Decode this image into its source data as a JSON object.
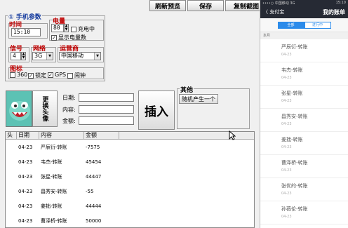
{
  "toolbar": {
    "refresh_label": "刷新预览",
    "save_label": "保存",
    "copy_label": "复制截图"
  },
  "phone_params": {
    "legend": "① 手机参数",
    "time_label": "时间",
    "time_value": "15:10",
    "battery_label": "电量",
    "battery_value": "80",
    "charging_label": "充电中",
    "charging_checked": false,
    "show_battery_label": "显示电量数",
    "show_battery_checked": true,
    "signal_label": "信号",
    "signal_value": "4",
    "network_label": "网络",
    "network_value": "3G",
    "carrier_label": "运营商",
    "carrier_value": "中国移动",
    "icons_label": "图标",
    "icon_options": [
      {
        "label": "360",
        "checked": false
      },
      {
        "label": "锁定",
        "checked": true
      },
      {
        "label": "GPS",
        "checked": true
      },
      {
        "label": "闹钟",
        "checked": false
      }
    ]
  },
  "entry": {
    "avatar_button_label": "更换头像",
    "date_label": "日期:",
    "content_label": "内容:",
    "amount_label": "金额:",
    "date_value": "",
    "content_value": "",
    "amount_value": "",
    "insert_label": "插入",
    "other_legend": "其他",
    "random_label": "随机产生一个"
  },
  "table": {
    "headers": [
      "头",
      "日期",
      "内容",
      "金额"
    ],
    "rows": [
      {
        "date": "04-23",
        "content": "严辰衍-转账",
        "amount": "-7575"
      },
      {
        "date": "04-23",
        "content": "韦杰-转账",
        "amount": "45454"
      },
      {
        "date": "04-23",
        "content": "张星-转账",
        "amount": "44447"
      },
      {
        "date": "04-23",
        "content": "昌秀安-转账",
        "amount": "-55"
      },
      {
        "date": "04-23",
        "content": "姜拙-转账",
        "amount": "44444"
      },
      {
        "date": "04-23",
        "content": "曹泽桥-转账",
        "amount": "50000"
      }
    ]
  },
  "phone": {
    "carrier": "••••○ 中国移动 3G",
    "time": "15:10",
    "back_label": "〈 支付宝",
    "title": "我的账单",
    "tab_all": "全部",
    "tab_progress": "进行中",
    "month": "本月",
    "items": [
      {
        "name": "严辰衍-转账",
        "date": "04-23"
      },
      {
        "name": "韦杰-转账",
        "date": "04-23"
      },
      {
        "name": "张星-转账",
        "date": "04-23"
      },
      {
        "name": "昌秀安-转账",
        "date": "04-23"
      },
      {
        "name": "姜拙-转账",
        "date": "04-23"
      },
      {
        "name": "曹泽桥-转账",
        "date": "04-23"
      },
      {
        "name": "张优的-转账",
        "date": "04-23"
      },
      {
        "name": "孙薇伦-转账",
        "date": "04-23"
      }
    ]
  },
  "colors": {
    "legend_red": "#c00000",
    "legend_blue": "#1a3fa0",
    "avatar_bg": "#5cc2b4",
    "phone_bar": "#262a34",
    "phone_accent": "#2b8bea"
  }
}
